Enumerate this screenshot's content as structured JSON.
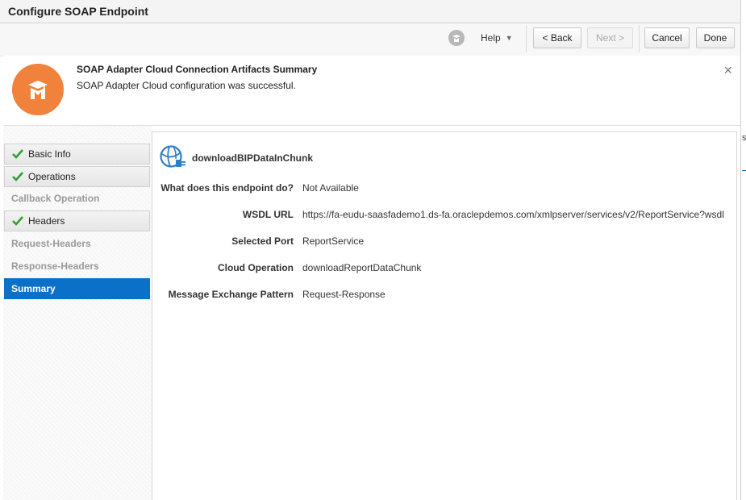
{
  "window": {
    "title": "Configure SOAP Endpoint"
  },
  "toolbar": {
    "help_label": "Help",
    "back_label": "< Back",
    "next_label": "Next >",
    "cancel_label": "Cancel",
    "done_label": "Done"
  },
  "banner": {
    "title": "SOAP Adapter Cloud Connection Artifacts Summary",
    "message": "SOAP Adapter Cloud configuration was successful.",
    "close": "×",
    "accent_color": "#f0823c"
  },
  "nav": {
    "items": [
      {
        "label": "Basic Info",
        "state": "done"
      },
      {
        "label": "Operations",
        "state": "done"
      },
      {
        "label": "Callback Operation",
        "state": "pending"
      },
      {
        "label": "Headers",
        "state": "done"
      },
      {
        "label": "Request-Headers",
        "state": "pending"
      },
      {
        "label": "Response-Headers",
        "state": "pending"
      },
      {
        "label": "Summary",
        "state": "active"
      }
    ],
    "active_color": "#0b71c8"
  },
  "summary": {
    "endpoint_name": "downloadBIPDataInChunk",
    "fields": [
      {
        "label": "What does this endpoint do?",
        "value": "Not Available"
      },
      {
        "label": "WSDL URL",
        "value": "https://fa-eudu-saasfademo1.ds-fa.oraclepdemos.com/xmlpserver/services/v2/ReportService?wsdl"
      },
      {
        "label": "Selected Port",
        "value": "ReportService"
      },
      {
        "label": "Cloud Operation",
        "value": "downloadReportDataChunk"
      },
      {
        "label": "Message Exchange Pattern",
        "value": "Request-Response"
      }
    ]
  },
  "background_edge": {
    "text": "s"
  }
}
